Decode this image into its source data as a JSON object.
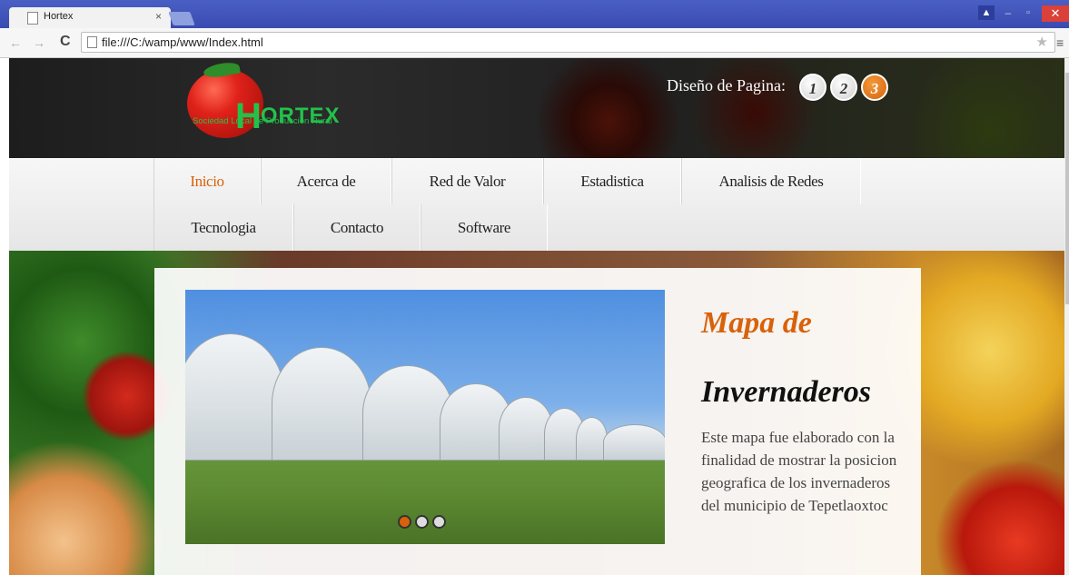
{
  "browser": {
    "tab_title": "Hortex",
    "tab_close": "×",
    "url": "file:///C:/wamp/www/Index.html",
    "back_icon": "←",
    "forward_icon": "→",
    "reload_icon": "C",
    "star_icon": "★",
    "menu_icon": "≡",
    "min_icon": "–",
    "max_icon": "▫",
    "close_icon": "✕",
    "user_icon": "▲"
  },
  "header": {
    "logo_letter": "H",
    "logo_rest": "ORTEX",
    "logo_subtitle": "Sociedad Local de Producción Rural",
    "design_label": "Diseño de Pagina:",
    "design_buttons": [
      "1",
      "2",
      "3"
    ]
  },
  "nav": {
    "row1": [
      "Inicio",
      "Acerca de",
      "Red de Valor",
      "Estadistica",
      "Analisis de Redes"
    ],
    "row2": [
      "Tecnologia",
      "Contacto",
      "Software"
    ],
    "active": "Inicio"
  },
  "main": {
    "heading_line1": "Mapa de",
    "heading_line2": "Invernaderos",
    "description": "Este mapa fue elaborado con la finalidad de mostrar la posicion geografica de los invernaderos del municipio de Tepetlaoxtoc",
    "slider_dots": 3,
    "active_dot": 1
  },
  "colors": {
    "accent": "#d8620a",
    "tabbar": "#3f51b5",
    "logo_green": "#23c14a"
  }
}
